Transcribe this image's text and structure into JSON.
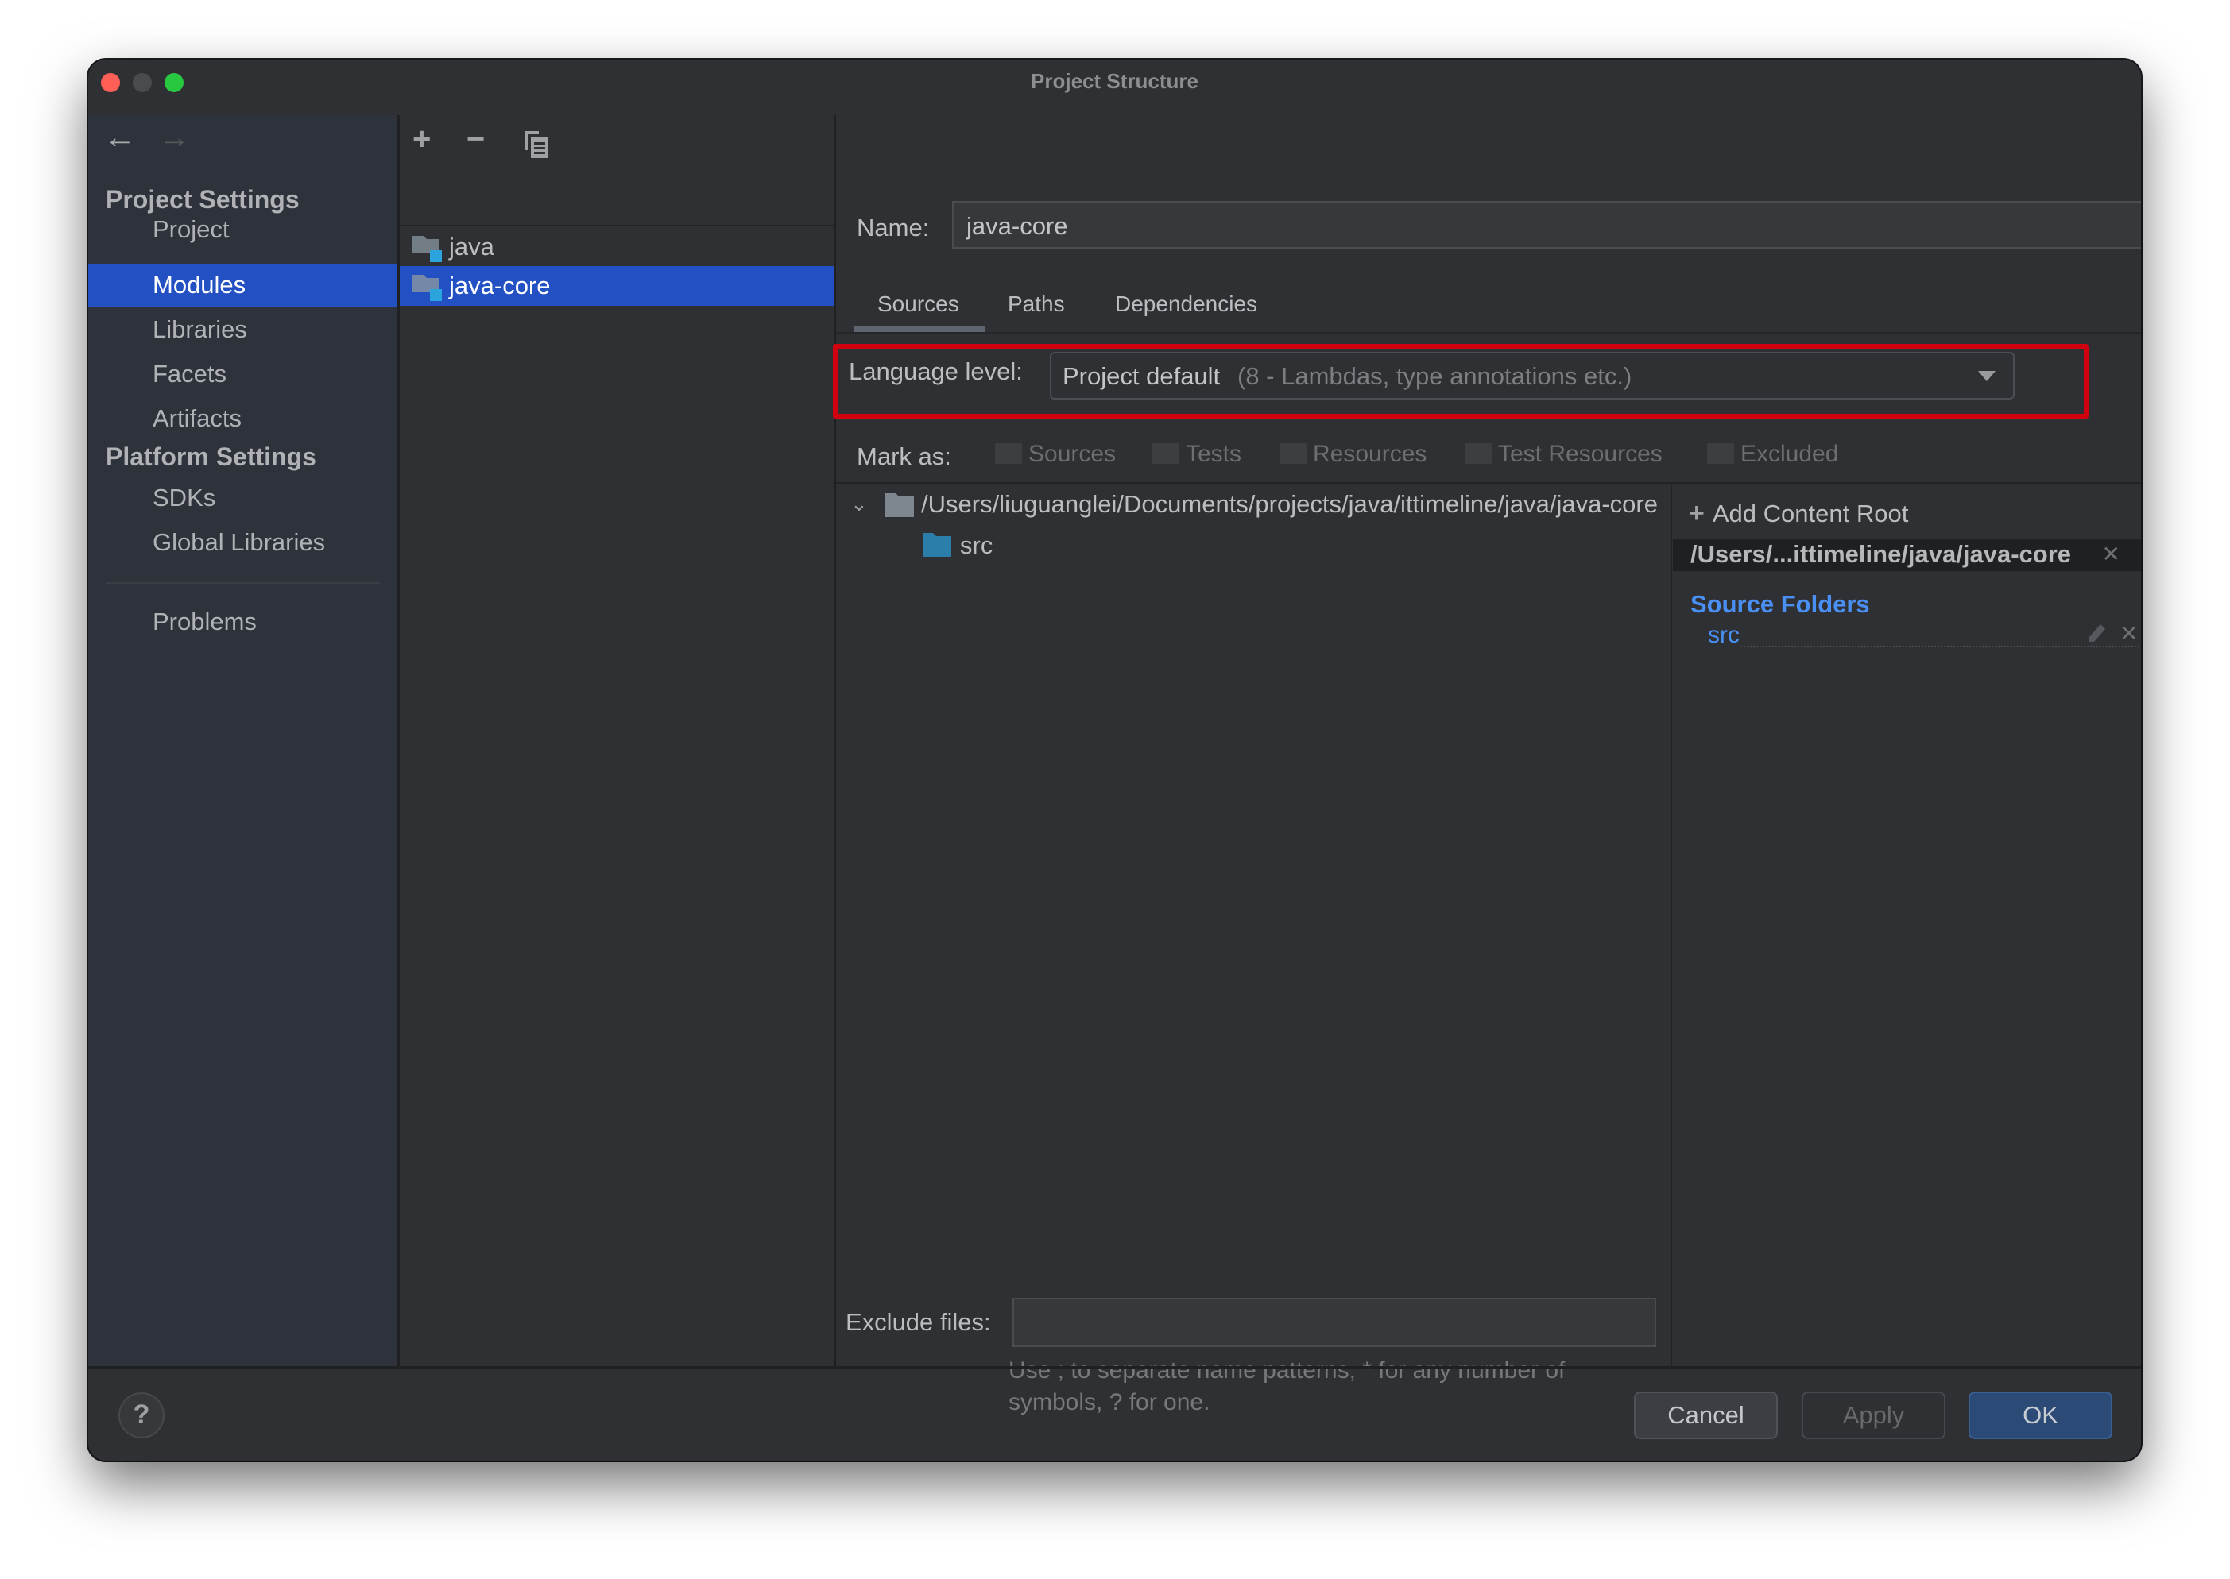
{
  "window": {
    "title": "Project Structure",
    "traffic_lights": {
      "close": "#ff5f57",
      "minimize": "#4a4b4e",
      "zoom": "#28c840"
    }
  },
  "nav": {
    "back_icon": "←",
    "forward_icon": "→"
  },
  "sidebar": {
    "sections": [
      {
        "header": "Project Settings",
        "items": [
          {
            "label": "Project",
            "selected": false
          },
          {
            "label": "Modules",
            "selected": true
          },
          {
            "label": "Libraries",
            "selected": false
          },
          {
            "label": "Facets",
            "selected": false
          },
          {
            "label": "Artifacts",
            "selected": false
          }
        ]
      },
      {
        "header": "Platform Settings",
        "items": [
          {
            "label": "SDKs",
            "selected": false
          },
          {
            "label": "Global Libraries",
            "selected": false
          }
        ]
      }
    ],
    "problems": "Problems"
  },
  "modules": {
    "toolbar": {
      "add": "+",
      "remove": "−",
      "copy": "copy"
    },
    "items": [
      {
        "name": "java",
        "selected": false
      },
      {
        "name": "java-core",
        "selected": true
      }
    ]
  },
  "module_detail": {
    "name_label": "Name:",
    "name_value": "java-core",
    "tabs": [
      {
        "label": "Sources",
        "active": true
      },
      {
        "label": "Paths",
        "active": false
      },
      {
        "label": "Dependencies",
        "active": false
      }
    ],
    "language_level": {
      "label": "Language level:",
      "value": "Project default",
      "hint": "(8 - Lambdas, type annotations etc.)",
      "highlight_color": "#d0000f"
    },
    "mark_as": {
      "label": "Mark as:",
      "options": [
        {
          "label": "Sources",
          "mnemonic": "S"
        },
        {
          "label": "Tests",
          "mnemonic": "T"
        },
        {
          "label": "Resources",
          "mnemonic": ""
        },
        {
          "label": "Test Resources",
          "mnemonic": ""
        },
        {
          "label": "Excluded",
          "mnemonic": "E"
        }
      ]
    },
    "tree": {
      "root": "/Users/liuguanglei/Documents/projects/java/ittimeline/java/java-core",
      "children": [
        "src"
      ]
    },
    "content_roots": {
      "add_label": "Add Content Root",
      "root_path": "/Users/...ittimeline/java/java-core",
      "source_folders_header": "Source Folders",
      "source_folders": [
        "src"
      ],
      "accent_color": "#4a8ff3"
    },
    "exclude_files": {
      "label": "Exclude files:",
      "value": "",
      "hint_line1": "Use ; to separate name patterns, * for any number of",
      "hint_line2": "symbols, ? for one."
    }
  },
  "footer": {
    "help": "?",
    "cancel": "Cancel",
    "apply": "Apply",
    "ok": "OK"
  }
}
